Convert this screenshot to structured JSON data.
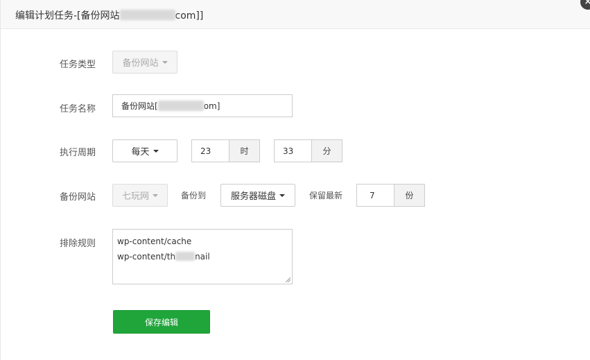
{
  "dialog": {
    "title_prefix": "编辑计划任务-[备份网站",
    "title_suffix": "com]]",
    "close_symbol": "×"
  },
  "form": {
    "task_type": {
      "label": "任务类型",
      "value": "备份网站"
    },
    "task_name": {
      "label": "任务名称",
      "value_prefix": "备份网站[",
      "value_suffix": "om]"
    },
    "period": {
      "label": "执行周期",
      "frequency": "每天",
      "hour": "23",
      "hour_unit": "时",
      "minute": "33",
      "minute_unit": "分"
    },
    "backup_site": {
      "label": "备份网站",
      "site": "七玩网",
      "backup_to_label": "备份到",
      "backup_to": "服务器磁盘",
      "keep_label": "保留最新",
      "keep_count": "7",
      "keep_unit": "份"
    },
    "exclude": {
      "label": "排除规则",
      "line1": "wp-content/cache",
      "line2_prefix": "wp-content/th",
      "line2_suffix": "nail"
    },
    "save_label": "保存编辑"
  }
}
